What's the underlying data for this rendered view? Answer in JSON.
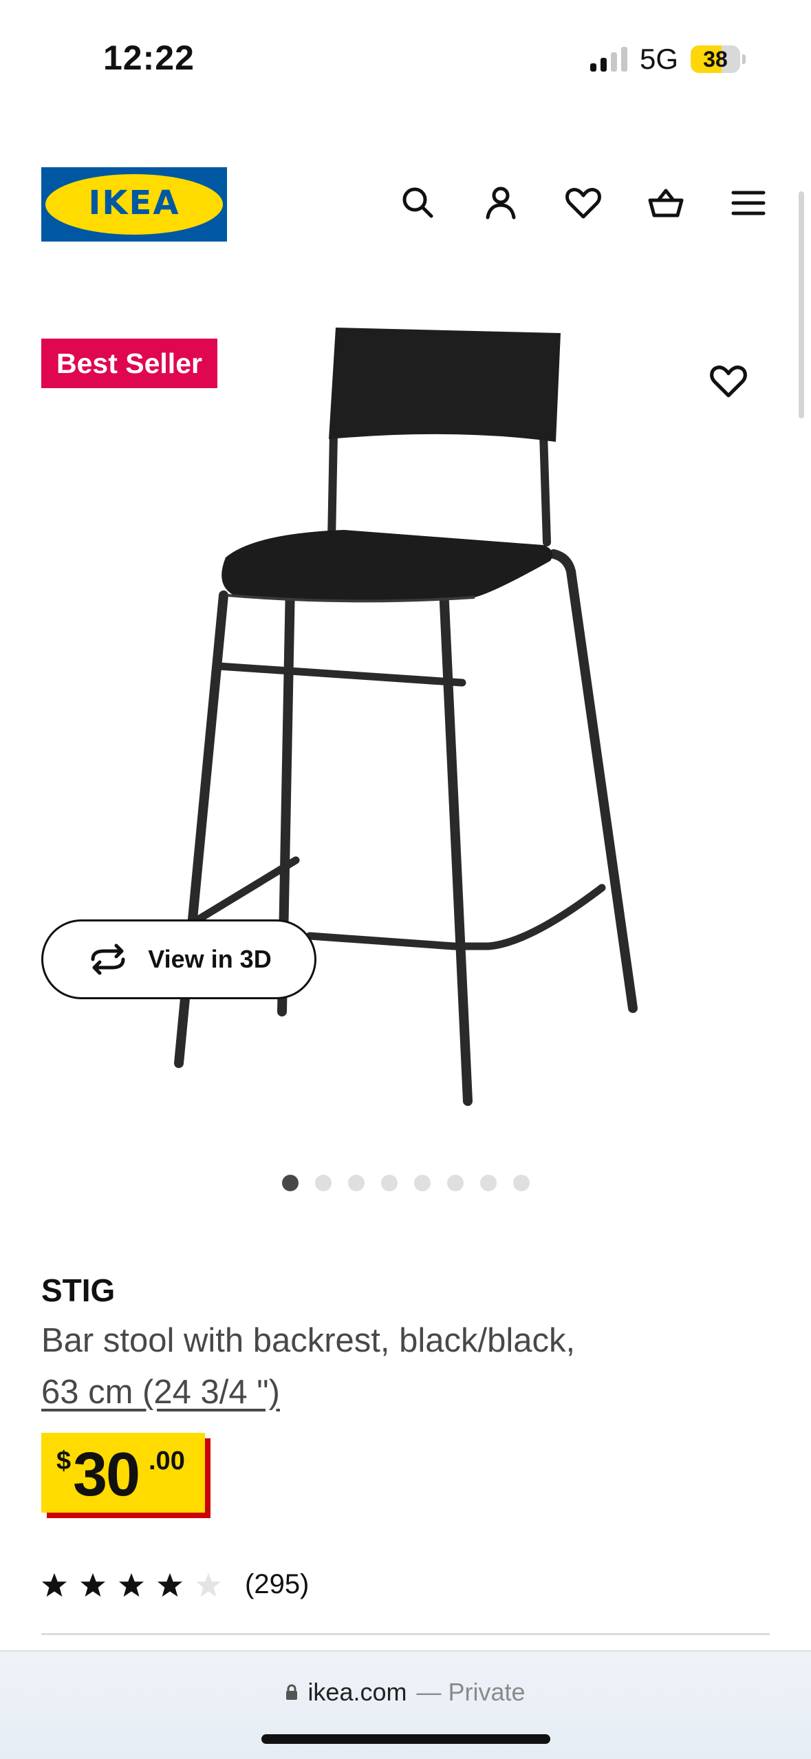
{
  "status_bar": {
    "time": "12:22",
    "network": "5G",
    "battery": "38"
  },
  "header": {
    "logo_text": "IKEA",
    "icons": [
      "search-icon",
      "account-icon",
      "wishlist-icon",
      "cart-icon",
      "menu-icon"
    ]
  },
  "product_image": {
    "badge": "Best Seller",
    "view_3d_label": "View in 3D",
    "carousel_total": 8,
    "carousel_active": 1
  },
  "product": {
    "name": "STIG",
    "description": "Bar stool with backrest, black/black,",
    "size": "63 cm (24 3/4 \")",
    "price": {
      "currency": "$",
      "integer": "30",
      "decimal": ".00"
    },
    "rating": {
      "stars": 4,
      "max": 5,
      "count": "(295)"
    }
  },
  "browser": {
    "domain": "ikea.com",
    "mode": "— Private"
  },
  "colors": {
    "ikea_blue": "#0058a3",
    "ikea_yellow": "#ffdb00",
    "badge_red": "#e00751",
    "price_shadow": "#cc0008"
  }
}
